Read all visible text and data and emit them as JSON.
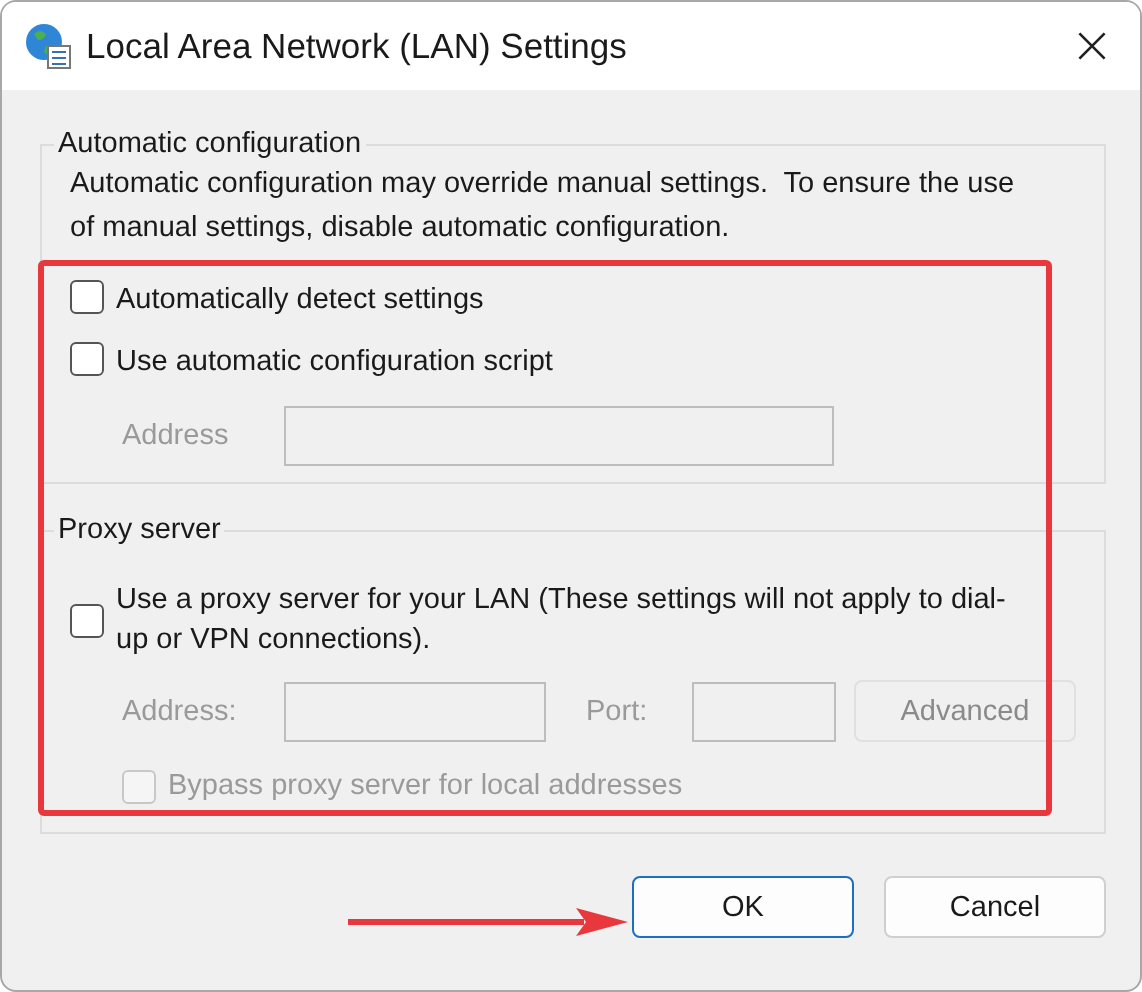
{
  "window": {
    "title": "Local Area Network (LAN) Settings"
  },
  "automatic_configuration": {
    "title": "Automatic configuration",
    "description": "Automatic configuration may override manual settings.  To ensure the use of manual settings, disable automatic configuration.",
    "options": [
      {
        "label": "Automatically detect settings",
        "checked": false,
        "disabled": false
      },
      {
        "label": "Use automatic configuration script",
        "checked": false,
        "disabled": false
      }
    ],
    "address": {
      "label": "Address",
      "disabled": true
    }
  },
  "proxy_server": {
    "title": "Proxy server",
    "use_proxy": {
      "label": "Use a proxy server for your LAN (These settings will not apply to dial-up or VPN connections).",
      "checked": false,
      "disabled": false
    },
    "address": {
      "label": "Address:",
      "disabled": true
    },
    "port": {
      "label": "Port:",
      "disabled": true
    },
    "advanced_button": {
      "label": "Advanced",
      "disabled": true
    },
    "bypass": {
      "label": "Bypass proxy server for local addresses",
      "checked": false,
      "disabled": true
    }
  },
  "buttons": [
    {
      "label": "OK",
      "default": true
    },
    {
      "label": "Cancel",
      "default": false
    }
  ]
}
